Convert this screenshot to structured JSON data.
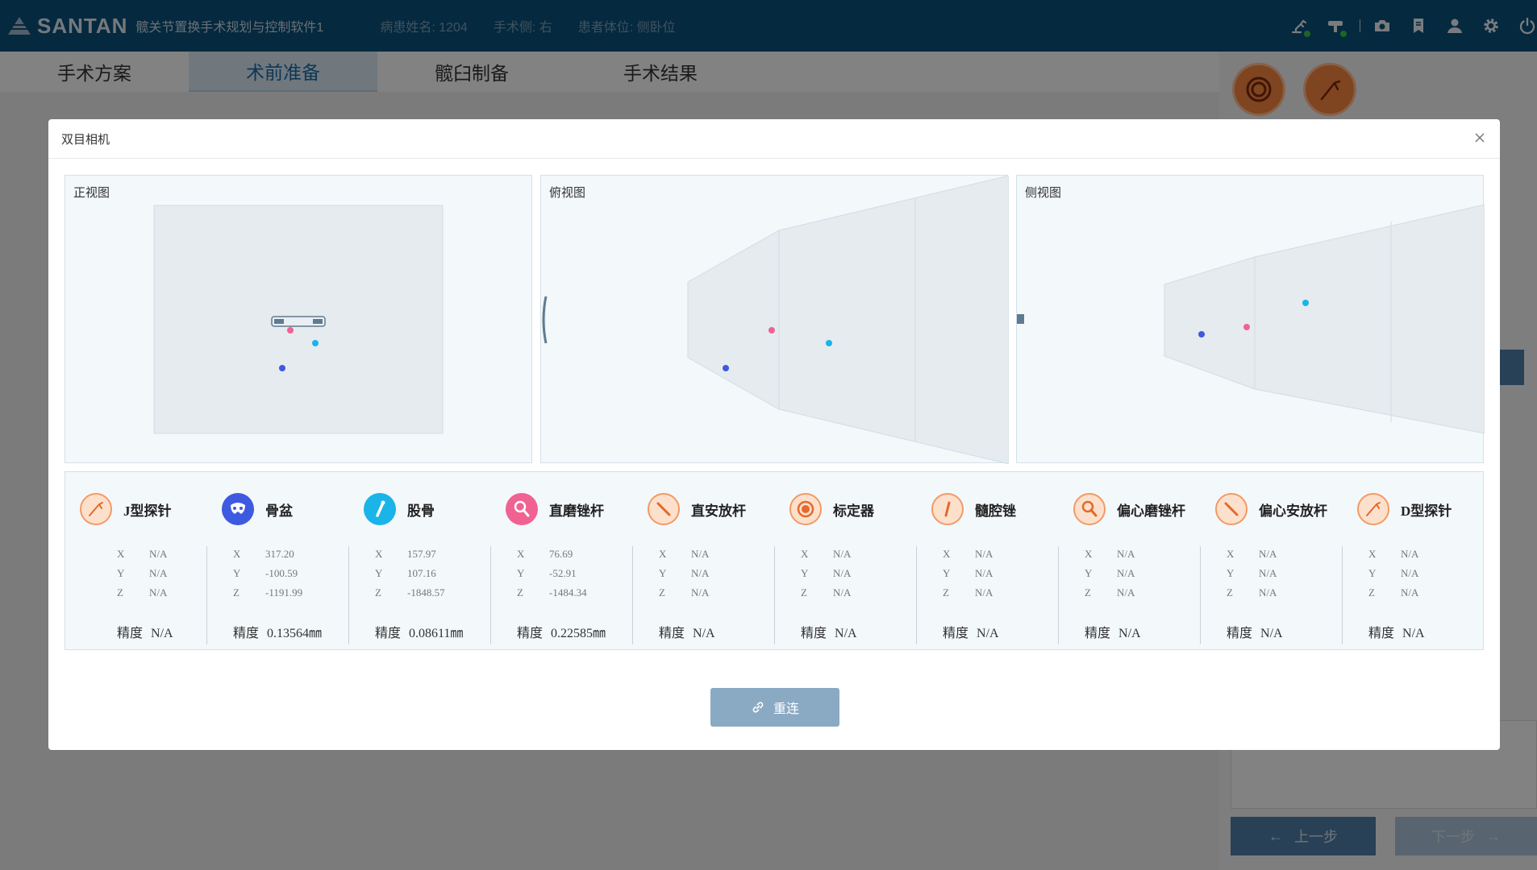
{
  "header": {
    "brand": "SANTAN",
    "app_title": "髋关节置换手术规划与控制软件1",
    "patient_name": "病患姓名: 1204",
    "surgery_side": "手术侧: 右",
    "patient_position": "患者体位: 侧卧位",
    "icons": [
      "robot-arm-icon",
      "tracker-icon",
      "camera-icon",
      "bookmark-icon",
      "user-icon",
      "settings-icon",
      "power-icon"
    ],
    "status_color": "#35c24a"
  },
  "tabs": [
    {
      "label": "手术方案",
      "active": false
    },
    {
      "label": "术前准备",
      "active": true
    },
    {
      "label": "髋臼制备",
      "active": false
    },
    {
      "label": "手术结果",
      "active": false
    }
  ],
  "right_panel": {
    "prev_label": "上一步",
    "next_label": "下一步"
  },
  "modal": {
    "title": "双目相机",
    "views": [
      {
        "label": "正视图"
      },
      {
        "label": "俯视图"
      },
      {
        "label": "侧视图"
      }
    ],
    "marker_colors": {
      "pink": "#f06292",
      "cyan": "#1ab4e8",
      "blue": "#3d5ae0"
    },
    "tools": [
      {
        "name": "J型探针",
        "icon": "j-probe-icon",
        "color": "#fbd2b6",
        "x": "N/A",
        "y": "N/A",
        "z": "N/A",
        "precision_label": "精度",
        "precision": "N/A"
      },
      {
        "name": "骨盆",
        "icon": "pelvis-icon",
        "color": "#3d5ae0",
        "x": "317.20",
        "y": "-100.59",
        "z": "-1191.99",
        "precision_label": "精度",
        "precision": "0.13564㎜"
      },
      {
        "name": "股骨",
        "icon": "femur-icon",
        "color": "#1ab4e8",
        "x": "157.97",
        "y": "107.16",
        "z": "-1848.57",
        "precision_label": "精度",
        "precision": "0.08611㎜"
      },
      {
        "name": "直磨锉杆",
        "icon": "straight-reamer-icon",
        "color": "#f06292",
        "x": "76.69",
        "y": "-52.91",
        "z": "-1484.34",
        "precision_label": "精度",
        "precision": "0.22585㎜"
      },
      {
        "name": "直安放杆",
        "icon": "straight-placement-icon",
        "color": "#fbd2b6",
        "x": "N/A",
        "y": "N/A",
        "z": "N/A",
        "precision_label": "精度",
        "precision": "N/A"
      },
      {
        "name": "标定器",
        "icon": "calibrator-icon",
        "color": "#fbd2b6",
        "x": "N/A",
        "y": "N/A",
        "z": "N/A",
        "precision_label": "精度",
        "precision": "N/A"
      },
      {
        "name": "髓腔锉",
        "icon": "canal-rasp-icon",
        "color": "#fbd2b6",
        "x": "N/A",
        "y": "N/A",
        "z": "N/A",
        "precision_label": "精度",
        "precision": "N/A"
      },
      {
        "name": "偏心磨锉杆",
        "icon": "offset-reamer-icon",
        "color": "#fbd2b6",
        "x": "N/A",
        "y": "N/A",
        "z": "N/A",
        "precision_label": "精度",
        "precision": "N/A"
      },
      {
        "name": "偏心安放杆",
        "icon": "offset-placement-icon",
        "color": "#fbd2b6",
        "x": "N/A",
        "y": "N/A",
        "z": "N/A",
        "precision_label": "精度",
        "precision": "N/A"
      },
      {
        "name": "D型探针",
        "icon": "d-probe-icon",
        "color": "#fbd2b6",
        "x": "N/A",
        "y": "N/A",
        "z": "N/A",
        "precision_label": "精度",
        "precision": "N/A"
      }
    ],
    "reconnect_label": "重连"
  }
}
